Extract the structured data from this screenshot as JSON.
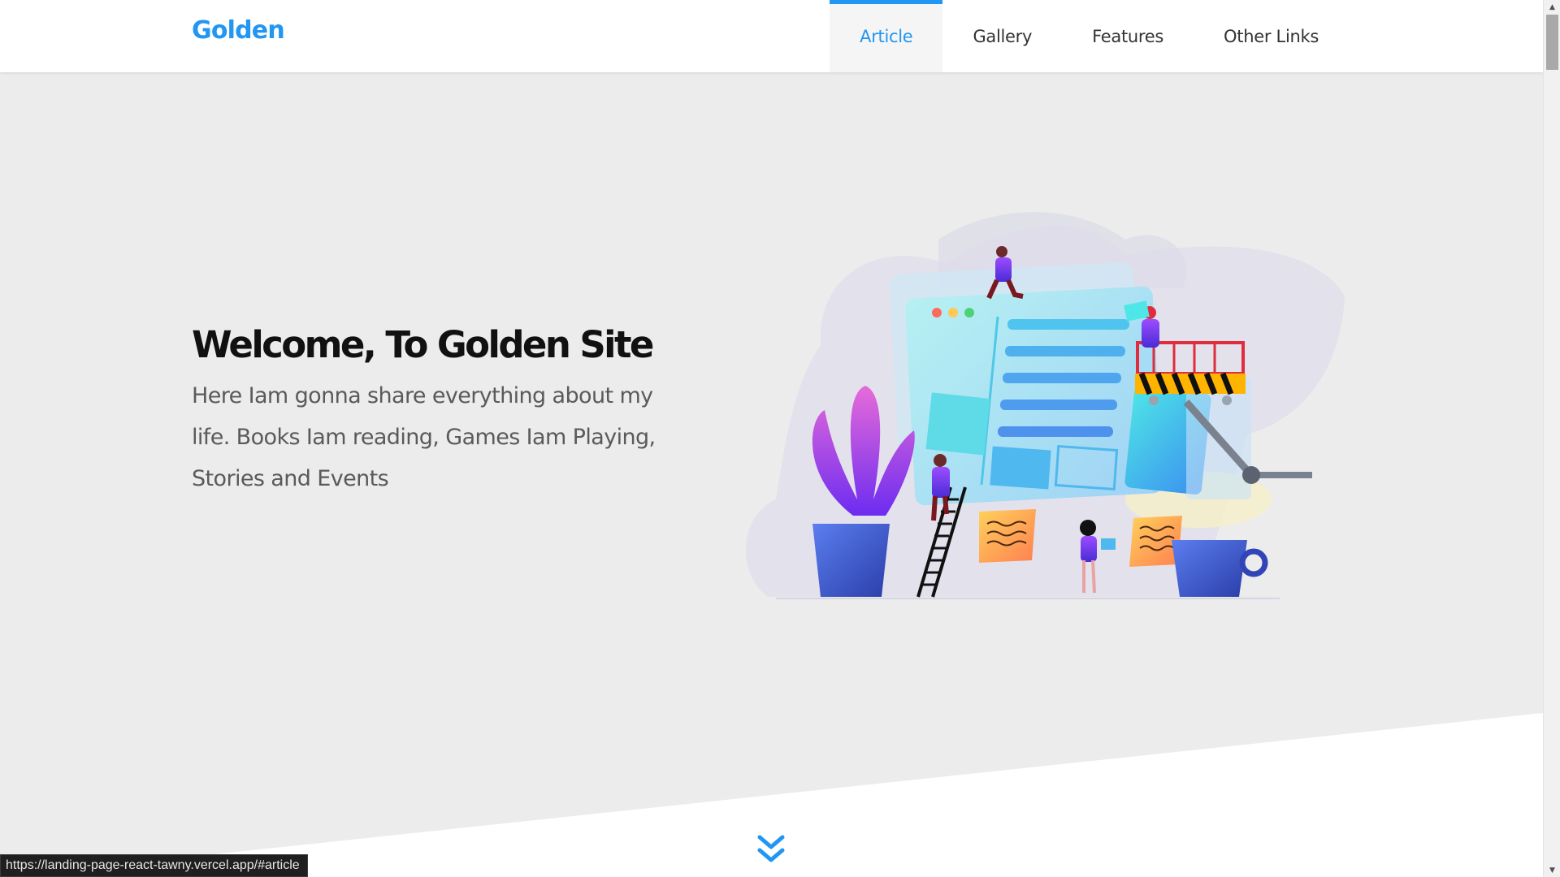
{
  "header": {
    "logo": "Golden",
    "nav": [
      {
        "label": "Article",
        "active": true
      },
      {
        "label": "Gallery",
        "active": false
      },
      {
        "label": "Features",
        "active": false
      },
      {
        "label": "Other Links",
        "active": false
      }
    ]
  },
  "hero": {
    "title": "Welcome, To Golden Site",
    "text": "Here Iam gonna share everything about my life. Books Iam reading, Games Iam Playing, Stories and Events",
    "illustration": "website-construction-team-illustration"
  },
  "scroll_down_icon": "double-chevron-down-icon",
  "status_bar": {
    "url": "https://landing-page-react-tawny.vercel.app/#article"
  },
  "colors": {
    "accent": "#2196f3",
    "hero_bg": "#ececec",
    "text_dark": "#111111",
    "text_muted": "#5a5a5a"
  }
}
